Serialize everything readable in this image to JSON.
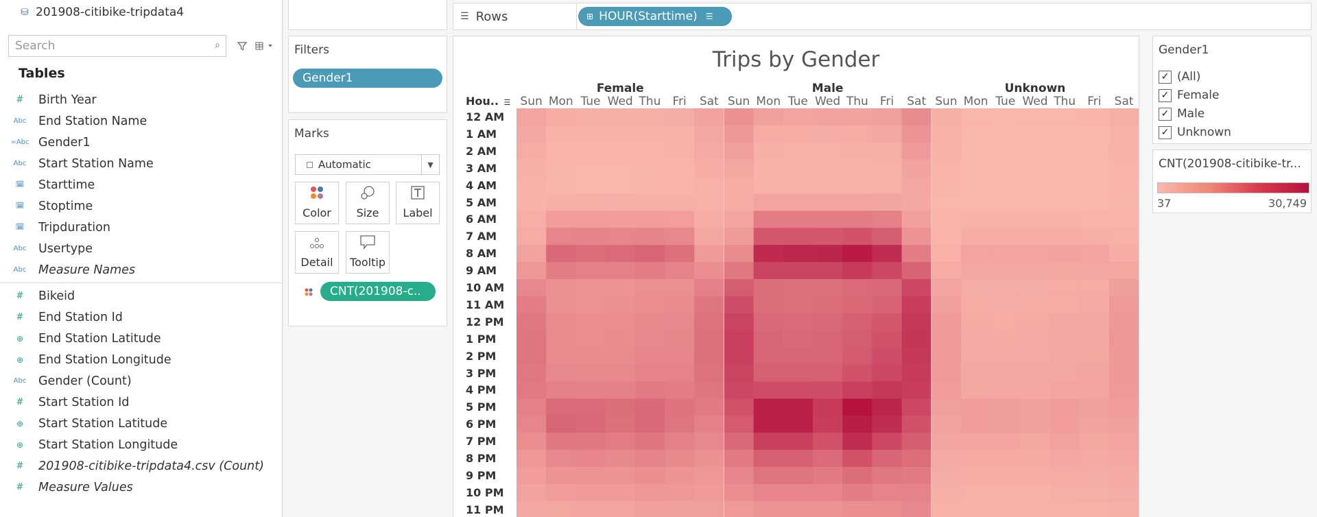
{
  "datasource": {
    "name": "201908-citibike-tripdata4"
  },
  "search": {
    "placeholder": "Search"
  },
  "tables_heading": "Tables",
  "dimensions": [
    {
      "type": "#",
      "label": "Birth Year",
      "italic": false
    },
    {
      "type": "Abc",
      "label": "End Station Name",
      "italic": false
    },
    {
      "type": "=Abc",
      "label": "Gender1",
      "italic": false
    },
    {
      "type": "Abc",
      "label": "Start Station Name",
      "italic": false
    },
    {
      "type": "date",
      "label": "Starttime",
      "italic": false
    },
    {
      "type": "date",
      "label": "Stoptime",
      "italic": false
    },
    {
      "type": "date",
      "label": "Tripduration",
      "italic": false
    },
    {
      "type": "Abc",
      "label": "Usertype",
      "italic": false
    },
    {
      "type": "Abc",
      "label": "Measure Names",
      "italic": true
    }
  ],
  "measures": [
    {
      "type": "#",
      "label": "Bikeid",
      "italic": false
    },
    {
      "type": "#",
      "label": "End Station Id",
      "italic": false
    },
    {
      "type": "globe",
      "label": "End Station Latitude",
      "italic": false
    },
    {
      "type": "globe",
      "label": "End Station Longitude",
      "italic": false
    },
    {
      "type": "Abc",
      "label": "Gender (Count)",
      "italic": false
    },
    {
      "type": "#",
      "label": "Start Station Id",
      "italic": false
    },
    {
      "type": "globe",
      "label": "Start Station Latitude",
      "italic": false
    },
    {
      "type": "globe",
      "label": "Start Station Longitude",
      "italic": false
    },
    {
      "type": "#",
      "label": "201908-citibike-tripdata4.csv (Count)",
      "italic": true
    },
    {
      "type": "#",
      "label": "Measure Values",
      "italic": true
    }
  ],
  "filters": {
    "title": "Filters",
    "pill": "Gender1"
  },
  "marks": {
    "title": "Marks",
    "type": "Automatic",
    "buttons": [
      "Color",
      "Size",
      "Label",
      "Detail",
      "Tooltip"
    ],
    "color_pill": "CNT(201908-c.."
  },
  "rows": {
    "label": "Rows",
    "pill": "HOUR(Starttime)"
  },
  "legend": {
    "filter_title": "Gender1",
    "options": [
      "(All)",
      "Female",
      "Male",
      "Unknown"
    ],
    "color_title": "CNT(201908-citibike-tr...",
    "min": "37",
    "max": "30,749",
    "colors": [
      "#fbb7ad",
      "#b5123e"
    ]
  },
  "chart_data": {
    "type": "heatmap",
    "title": "Trips by Gender",
    "row_header": "Hou..",
    "column_groups": [
      "Female",
      "Male",
      "Unknown"
    ],
    "days": [
      "Sun",
      "Mon",
      "Tue",
      "Wed",
      "Thu",
      "Fri",
      "Sat"
    ],
    "hours": [
      "12 AM",
      "1 AM",
      "2 AM",
      "3 AM",
      "4 AM",
      "5 AM",
      "6 AM",
      "7 AM",
      "8 AM",
      "9 AM",
      "10 AM",
      "11 AM",
      "12 PM",
      "1 PM",
      "2 PM",
      "3 PM",
      "4 PM",
      "5 PM",
      "6 PM",
      "7 PM",
      "8 PM",
      "9 PM",
      "10 PM",
      "11 PM"
    ],
    "color_min": 37,
    "color_max": 30749,
    "series": [
      {
        "name": "Female",
        "values": [
          [
            2500,
            1200,
            1000,
            1100,
            1100,
            1300,
            2800
          ],
          [
            1800,
            600,
            500,
            500,
            600,
            700,
            2100
          ],
          [
            1400,
            400,
            300,
            300,
            400,
            500,
            1700
          ],
          [
            900,
            250,
            200,
            200,
            250,
            300,
            1200
          ],
          [
            600,
            250,
            200,
            200,
            250,
            300,
            800
          ],
          [
            600,
            900,
            900,
            900,
            900,
            900,
            700
          ],
          [
            1000,
            3500,
            3600,
            3500,
            3600,
            3300,
            1200
          ],
          [
            1500,
            7500,
            7800,
            7500,
            7800,
            7000,
            2200
          ],
          [
            2800,
            13000,
            12000,
            12500,
            13500,
            11500,
            3800
          ],
          [
            4500,
            9000,
            8500,
            8500,
            9000,
            8000,
            6000
          ],
          [
            7000,
            5500,
            5200,
            5200,
            5800,
            5800,
            8500
          ],
          [
            9000,
            5800,
            5300,
            5500,
            6000,
            6300,
            10500
          ],
          [
            10000,
            6500,
            6000,
            6200,
            6800,
            7000,
            11000
          ],
          [
            10500,
            6500,
            6200,
            6300,
            7000,
            7300,
            11500
          ],
          [
            10500,
            6500,
            6300,
            6300,
            7200,
            7500,
            11500
          ],
          [
            10000,
            7000,
            6800,
            6800,
            7800,
            8000,
            11000
          ],
          [
            9500,
            8500,
            8200,
            8300,
            9500,
            9000,
            10500
          ],
          [
            8500,
            12500,
            12500,
            12000,
            13000,
            11000,
            9500
          ],
          [
            7500,
            13500,
            13000,
            11500,
            13000,
            10500,
            8500
          ],
          [
            6000,
            10000,
            10000,
            9000,
            10500,
            8500,
            7000
          ],
          [
            4500,
            7000,
            7200,
            6800,
            8000,
            6800,
            5500
          ],
          [
            3500,
            5000,
            5200,
            5200,
            6000,
            5200,
            4500
          ],
          [
            2800,
            3500,
            3800,
            3800,
            4500,
            4200,
            3800
          ],
          [
            1800,
            2200,
            2500,
            2500,
            3200,
            3200,
            3200
          ]
        ]
      },
      {
        "name": "Male",
        "values": [
          [
            5500,
            3000,
            2500,
            2700,
            2800,
            3200,
            6500
          ],
          [
            4200,
            1500,
            1200,
            1300,
            1500,
            1800,
            5000
          ],
          [
            3200,
            900,
            700,
            800,
            900,
            1100,
            4000
          ],
          [
            2200,
            600,
            500,
            500,
            600,
            700,
            2800
          ],
          [
            1500,
            600,
            500,
            500,
            600,
            700,
            2000
          ],
          [
            1500,
            2500,
            2400,
            2400,
            2500,
            2300,
            1800
          ],
          [
            2500,
            9000,
            9200,
            9000,
            9200,
            8500,
            3000
          ],
          [
            3800,
            16000,
            16500,
            16000,
            17000,
            15000,
            5200
          ],
          [
            6500,
            25500,
            26000,
            26500,
            29000,
            25000,
            9000
          ],
          [
            10000,
            20000,
            20000,
            20000,
            22000,
            19500,
            14000
          ],
          [
            15000,
            12000,
            11500,
            11500,
            12500,
            13000,
            19000
          ],
          [
            18000,
            12000,
            11500,
            11800,
            12800,
            14000,
            21500
          ],
          [
            20000,
            13000,
            12500,
            13000,
            14500,
            16000,
            22500
          ],
          [
            21000,
            13500,
            13000,
            13500,
            15000,
            17000,
            23000
          ],
          [
            21000,
            13500,
            13500,
            13500,
            15500,
            18000,
            22500
          ],
          [
            20000,
            14500,
            14500,
            14500,
            17000,
            19500,
            22000
          ],
          [
            19500,
            18500,
            18500,
            18000,
            21000,
            22500,
            21500
          ],
          [
            17500,
            27500,
            27500,
            22000,
            30749,
            26500,
            19500
          ],
          [
            15500,
            27500,
            27500,
            21500,
            28500,
            25000,
            17500
          ],
          [
            13000,
            21000,
            21000,
            17500,
            25000,
            19000,
            15000
          ],
          [
            9500,
            14500,
            14500,
            12500,
            17000,
            13500,
            12000
          ],
          [
            7500,
            10500,
            10500,
            9500,
            12000,
            10000,
            9500
          ],
          [
            6000,
            7500,
            7500,
            7500,
            9000,
            8000,
            8000
          ],
          [
            4000,
            5000,
            5000,
            5000,
            6000,
            6200,
            7000
          ]
        ]
      },
      {
        "name": "Unknown",
        "values": [
          [
            900,
            200,
            150,
            200,
            200,
            300,
            1000
          ],
          [
            700,
            120,
            100,
            120,
            150,
            200,
            800
          ],
          [
            500,
            80,
            70,
            80,
            100,
            150,
            600
          ],
          [
            400,
            60,
            50,
            60,
            80,
            100,
            400
          ],
          [
            250,
            50,
            40,
            50,
            60,
            80,
            300
          ],
          [
            200,
            150,
            150,
            150,
            150,
            150,
            250
          ],
          [
            300,
            500,
            500,
            500,
            500,
            450,
            400
          ],
          [
            450,
            1200,
            1200,
            1200,
            1200,
            1000,
            700
          ],
          [
            800,
            2600,
            2600,
            2600,
            2800,
            2400,
            1200
          ],
          [
            1400,
            2000,
            2000,
            2000,
            2200,
            2000,
            2200
          ],
          [
            2400,
            1300,
            1300,
            1300,
            1400,
            1500,
            3400
          ],
          [
            3200,
            1400,
            1300,
            1400,
            1500,
            1700,
            4000
          ],
          [
            3800,
            1600,
            1500,
            1600,
            1800,
            2000,
            4300
          ],
          [
            4000,
            1700,
            1600,
            1700,
            1900,
            2100,
            4500
          ],
          [
            4000,
            1700,
            1700,
            1700,
            2000,
            2200,
            4300
          ],
          [
            3800,
            1800,
            1800,
            1800,
            2100,
            2300,
            4200
          ],
          [
            3600,
            2200,
            2100,
            2100,
            2500,
            2500,
            4000
          ],
          [
            3200,
            3500,
            3400,
            3000,
            3700,
            3000,
            3500
          ],
          [
            2800,
            3500,
            3400,
            3000,
            3600,
            2800,
            3100
          ],
          [
            2300,
            2400,
            2400,
            2200,
            2700,
            2200,
            2600
          ],
          [
            1700,
            1600,
            1600,
            1600,
            1900,
            1700,
            2000
          ],
          [
            1300,
            1200,
            1200,
            1200,
            1400,
            1300,
            1600
          ],
          [
            1000,
            800,
            800,
            800,
            1000,
            1000,
            1300
          ],
          [
            700,
            500,
            500,
            500,
            700,
            800,
            1100
          ]
        ]
      }
    ]
  }
}
